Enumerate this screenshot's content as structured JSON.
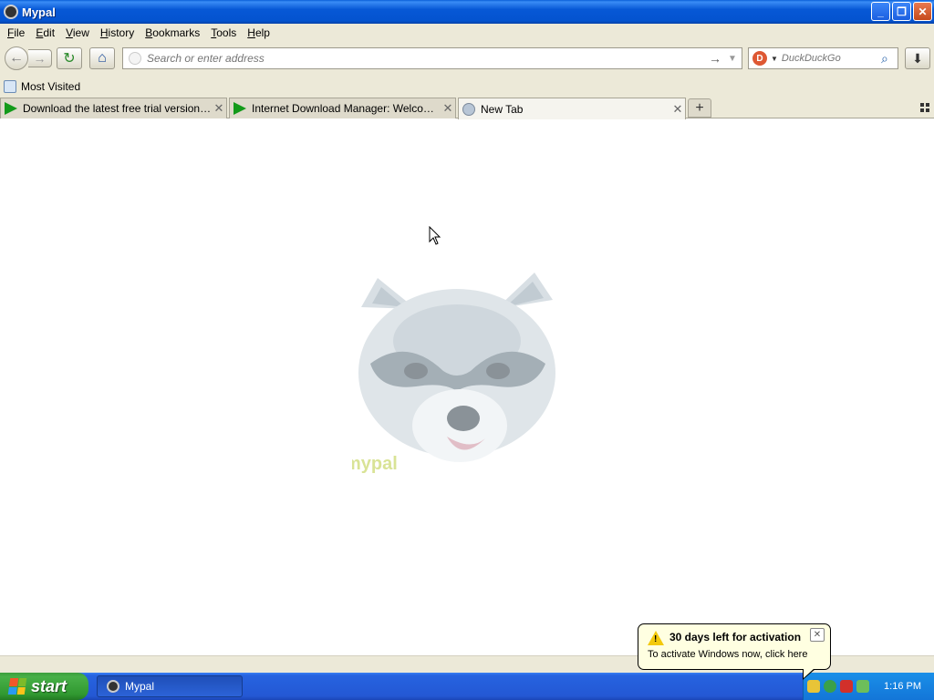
{
  "window": {
    "title": "Mypal"
  },
  "window_buttons": {
    "minimize": "_",
    "restore": "❐",
    "close": "✕"
  },
  "menu": [
    {
      "underline": "F",
      "rest": "ile"
    },
    {
      "underline": "E",
      "rest": "dit"
    },
    {
      "underline": "V",
      "rest": "iew"
    },
    {
      "underline": "H",
      "rest": "istory"
    },
    {
      "underline": "B",
      "rest": "ookmarks"
    },
    {
      "underline": "T",
      "rest": "ools"
    },
    {
      "underline": "H",
      "rest": "elp"
    }
  ],
  "navigation": {
    "back_glyph": "←",
    "forward_glyph": "→",
    "reload_glyph": "↻",
    "home_glyph": "⌂",
    "url_placeholder": "Search or enter address",
    "url_value": "",
    "go_glyph": "→",
    "dropdown_glyph": "▼",
    "search_engine_glyph": "D",
    "search_placeholder": "DuckDuckGo",
    "search_glyph": "⌕",
    "download_glyph": "⬇"
  },
  "bookmarks": {
    "most_visited": "Most Visited"
  },
  "tabs": [
    {
      "label": "Download the latest free trial version of I...",
      "icon": "idm-arrow-icon",
      "active": false
    },
    {
      "label": "Internet Download Manager: Welcome to...",
      "icon": "idm-arrow-icon",
      "active": false
    },
    {
      "label": "New Tab",
      "icon": "globe-icon",
      "active": true
    }
  ],
  "tab_close_glyph": "✕",
  "new_tab_glyph": "+",
  "content": {
    "logo_text": "mypal"
  },
  "taskbar": {
    "start_label": "start",
    "task_label": "Mypal",
    "clock": "1:16 PM"
  },
  "balloon": {
    "title": "30 days left for activation",
    "text": "To activate Windows now, click here",
    "close_glyph": "✕",
    "warning_mark": "!"
  },
  "colors": {
    "titlebar": "#0453cf",
    "chrome": "#ece9d8",
    "start": "#309830",
    "taskbar": "#2458d4",
    "balloon": "#ffffe1",
    "idm_green": "#139a1a"
  }
}
